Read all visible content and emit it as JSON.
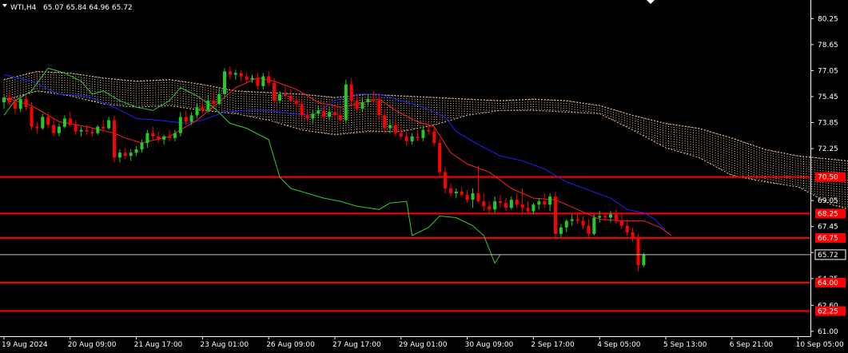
{
  "header": {
    "symbol_label": "WTI,H4",
    "ohlc_label": "65.07 65.84 64.96 65.72"
  },
  "chart_data": {
    "type": "candlestick",
    "symbol": "WTI",
    "timeframe": "H4",
    "last_price": 65.72,
    "ylim": [
      60.7,
      81.2
    ],
    "y_ticks": [
      "80.25",
      "78.65",
      "77.05",
      "75.45",
      "73.85",
      "72.25",
      "69.05",
      "67.45",
      "65.85",
      "64.25",
      "62.60",
      "61.00"
    ],
    "x_labels": [
      "19 Aug 2024",
      "20 Aug 09:00",
      "21 Aug 17:00",
      "23 Aug 01:00",
      "26 Aug 09:00",
      "27 Aug 17:00",
      "29 Aug 01:00",
      "30 Aug 09:00",
      "2 Sep 17:00",
      "4 Sep 05:00",
      "5 Sep 13:00",
      "6 Sep 21:00",
      "10 Sep 05:00"
    ],
    "x_label_bars": [
      0,
      12,
      24,
      36,
      48,
      60,
      72,
      84,
      96,
      108,
      120,
      132,
      144
    ],
    "levels": [
      {
        "label": "70.50",
        "value": 70.5
      },
      {
        "label": "68.25",
        "value": 68.25
      },
      {
        "label": "66.75",
        "value": 66.75
      },
      {
        "label": "64.00",
        "value": 64.0
      },
      {
        "label": "62.25",
        "value": 62.25
      }
    ],
    "colors": {
      "background": "#000000",
      "bull": "#22cc22",
      "bear": "#ff0000",
      "level_line": "#ff0000",
      "price_line": "#c0c0c0",
      "tenkan": "#ff2020",
      "kijun": "#2020ff",
      "chikou": "#33cc33",
      "cloud": "#f0c8a0",
      "axis_text": "#ffffff",
      "level_box": "#ff0000"
    },
    "candles": [
      [
        75.1,
        75.6,
        74.7,
        75.4
      ],
      [
        75.4,
        75.8,
        74.9,
        75.1
      ],
      [
        75.1,
        75.4,
        74.4,
        74.7
      ],
      [
        74.7,
        75.4,
        74.5,
        75.3
      ],
      [
        75.3,
        75.6,
        74.6,
        74.8
      ],
      [
        74.8,
        75.1,
        73.4,
        73.6
      ],
      [
        73.6,
        73.9,
        73.2,
        73.5
      ],
      [
        73.5,
        74.4,
        73.4,
        74.2
      ],
      [
        74.2,
        74.5,
        73.5,
        73.7
      ],
      [
        73.7,
        74.1,
        73.0,
        73.2
      ],
      [
        73.2,
        73.8,
        73.0,
        73.6
      ],
      [
        73.6,
        74.3,
        73.5,
        74.1
      ],
      [
        74.1,
        74.5,
        73.6,
        73.7
      ],
      [
        73.7,
        74.0,
        73.1,
        73.3
      ],
      [
        73.3,
        73.6,
        73.0,
        73.4
      ],
      [
        73.4,
        73.7,
        73.1,
        73.3
      ],
      [
        73.3,
        73.5,
        73.0,
        73.2
      ],
      [
        73.2,
        73.7,
        73.1,
        73.6
      ],
      [
        73.6,
        74.0,
        73.3,
        73.5
      ],
      [
        73.5,
        74.2,
        73.4,
        74.0
      ],
      [
        74.0,
        74.3,
        71.4,
        71.7
      ],
      [
        71.7,
        72.2,
        71.4,
        72.0
      ],
      [
        72.0,
        72.3,
        71.6,
        71.8
      ],
      [
        71.8,
        72.2,
        71.5,
        72.0
      ],
      [
        72.0,
        72.4,
        71.8,
        72.2
      ],
      [
        72.2,
        72.8,
        72.0,
        72.6
      ],
      [
        72.6,
        73.4,
        72.3,
        73.2
      ],
      [
        73.2,
        73.6,
        72.8,
        73.0
      ],
      [
        73.0,
        73.3,
        72.6,
        72.8
      ],
      [
        72.8,
        73.1,
        72.5,
        73.0
      ],
      [
        73.0,
        73.4,
        72.7,
        72.9
      ],
      [
        72.9,
        73.4,
        72.7,
        73.2
      ],
      [
        73.2,
        74.5,
        73.0,
        74.2
      ],
      [
        74.2,
        74.6,
        73.7,
        73.9
      ],
      [
        73.9,
        74.5,
        73.7,
        74.3
      ],
      [
        74.3,
        75.0,
        74.1,
        74.8
      ],
      [
        74.8,
        75.3,
        74.4,
        74.6
      ],
      [
        74.6,
        75.5,
        74.5,
        75.2
      ],
      [
        75.2,
        75.7,
        74.8,
        75.0
      ],
      [
        75.0,
        76.0,
        74.9,
        75.6
      ],
      [
        75.6,
        77.2,
        75.4,
        77.0
      ],
      [
        77.0,
        77.3,
        76.5,
        76.8
      ],
      [
        76.8,
        77.1,
        76.5,
        76.9
      ],
      [
        76.9,
        77.1,
        76.4,
        76.7
      ],
      [
        76.7,
        76.9,
        76.3,
        76.5
      ],
      [
        76.5,
        76.8,
        76.3,
        76.6
      ],
      [
        76.6,
        76.9,
        75.9,
        76.1
      ],
      [
        76.1,
        76.9,
        75.9,
        76.7
      ],
      [
        76.7,
        77.0,
        76.1,
        76.3
      ],
      [
        76.3,
        76.6,
        75.0,
        75.2
      ],
      [
        75.2,
        75.8,
        75.0,
        75.6
      ],
      [
        75.6,
        76.1,
        75.3,
        75.5
      ],
      [
        75.5,
        75.9,
        75.0,
        75.2
      ],
      [
        75.2,
        75.5,
        74.8,
        75.0
      ],
      [
        75.0,
        75.3,
        74.0,
        74.3
      ],
      [
        74.3,
        74.7,
        73.9,
        74.1
      ],
      [
        74.1,
        74.6,
        73.8,
        74.4
      ],
      [
        74.4,
        74.9,
        74.2,
        74.6
      ],
      [
        74.6,
        75.0,
        74.0,
        74.2
      ],
      [
        74.2,
        74.8,
        74.0,
        74.5
      ],
      [
        74.5,
        74.9,
        74.1,
        74.3
      ],
      [
        74.3,
        74.8,
        73.9,
        74.0
      ],
      [
        74.0,
        76.5,
        73.8,
        76.2
      ],
      [
        76.2,
        76.6,
        74.9,
        75.2
      ],
      [
        75.2,
        75.6,
        74.5,
        74.7
      ],
      [
        74.7,
        75.4,
        74.5,
        75.1
      ],
      [
        75.1,
        75.6,
        74.9,
        75.3
      ],
      [
        75.3,
        75.8,
        75.0,
        75.2
      ],
      [
        75.2,
        75.6,
        74.0,
        74.3
      ],
      [
        74.3,
        74.7,
        73.2,
        73.5
      ],
      [
        73.5,
        74.0,
        73.2,
        73.7
      ],
      [
        73.7,
        74.1,
        73.0,
        73.2
      ],
      [
        73.2,
        73.6,
        72.8,
        73.0
      ],
      [
        73.0,
        73.3,
        72.4,
        72.7
      ],
      [
        72.7,
        73.2,
        72.5,
        73.0
      ],
      [
        73.0,
        73.4,
        72.7,
        72.9
      ],
      [
        72.9,
        73.6,
        72.7,
        73.4
      ],
      [
        73.4,
        73.8,
        73.1,
        73.3
      ],
      [
        73.3,
        73.6,
        72.4,
        72.6
      ],
      [
        72.6,
        72.9,
        70.5,
        70.8
      ],
      [
        70.8,
        71.1,
        69.5,
        69.8
      ],
      [
        69.8,
        70.1,
        69.3,
        69.5
      ],
      [
        69.5,
        69.8,
        69.2,
        69.6
      ],
      [
        69.6,
        69.9,
        69.3,
        69.4
      ],
      [
        69.4,
        69.7,
        68.9,
        69.1
      ],
      [
        69.1,
        69.8,
        68.6,
        69.5
      ],
      [
        69.5,
        71.2,
        68.9,
        69.0
      ],
      [
        69.0,
        69.5,
        68.4,
        68.7
      ],
      [
        68.7,
        69.0,
        68.2,
        68.5
      ],
      [
        68.5,
        69.3,
        68.3,
        69.0
      ],
      [
        69.0,
        69.4,
        68.6,
        68.9
      ],
      [
        68.9,
        69.2,
        68.4,
        68.6
      ],
      [
        68.6,
        69.3,
        68.5,
        69.1
      ],
      [
        69.1,
        69.5,
        68.6,
        68.8
      ],
      [
        68.8,
        69.8,
        68.3,
        68.6
      ],
      [
        68.6,
        69.0,
        68.2,
        68.4
      ],
      [
        68.4,
        68.9,
        68.2,
        68.8
      ],
      [
        68.8,
        69.2,
        68.5,
        69.0
      ],
      [
        69.0,
        69.5,
        68.6,
        68.8
      ],
      [
        68.8,
        69.5,
        68.4,
        69.3
      ],
      [
        69.3,
        69.6,
        66.8,
        67.0
      ],
      [
        67.0,
        67.6,
        66.8,
        67.4
      ],
      [
        67.4,
        67.9,
        67.1,
        67.8
      ],
      [
        67.8,
        68.2,
        67.5,
        67.9
      ],
      [
        67.9,
        68.3,
        67.6,
        67.8
      ],
      [
        67.8,
        68.1,
        67.3,
        67.5
      ],
      [
        67.5,
        67.9,
        66.8,
        67.0
      ],
      [
        67.0,
        68.2,
        66.9,
        68.0
      ],
      [
        68.0,
        68.4,
        67.7,
        68.1
      ],
      [
        68.1,
        68.3,
        67.8,
        68.0
      ],
      [
        68.0,
        68.4,
        67.7,
        68.2
      ],
      [
        68.2,
        68.5,
        67.6,
        67.8
      ],
      [
        67.8,
        68.2,
        67.3,
        67.5
      ],
      [
        67.5,
        67.9,
        66.9,
        67.1
      ],
      [
        67.1,
        67.4,
        66.5,
        66.7
      ],
      [
        66.7,
        67.0,
        64.7,
        65.07
      ],
      [
        65.07,
        65.84,
        64.96,
        65.72
      ]
    ],
    "tenkan": [
      [
        0,
        75.4
      ],
      [
        5,
        74.9
      ],
      [
        10,
        73.9
      ],
      [
        15,
        73.6
      ],
      [
        20,
        73.2
      ],
      [
        22,
        72.9
      ],
      [
        25,
        72.6
      ],
      [
        30,
        73.0
      ],
      [
        35,
        74.0
      ],
      [
        39,
        75.1
      ],
      [
        42,
        76.0
      ],
      [
        46,
        76.6
      ],
      [
        49,
        76.4
      ],
      [
        53,
        75.9
      ],
      [
        57,
        75.1
      ],
      [
        61,
        74.8
      ],
      [
        64,
        75.0
      ],
      [
        68,
        75.3
      ],
      [
        71,
        74.6
      ],
      [
        75,
        73.9
      ],
      [
        78,
        73.6
      ],
      [
        81,
        72.0
      ],
      [
        84,
        71.3
      ],
      [
        88,
        70.8
      ],
      [
        92,
        69.8
      ],
      [
        96,
        69.2
      ],
      [
        100,
        69.1
      ],
      [
        104,
        68.5
      ],
      [
        108,
        67.9
      ],
      [
        112,
        67.8
      ],
      [
        116,
        67.8
      ],
      [
        119,
        67.4
      ],
      [
        121,
        66.9
      ]
    ],
    "kijun": [
      [
        0,
        76.8
      ],
      [
        5,
        76.4
      ],
      [
        10,
        75.6
      ],
      [
        15,
        75.5
      ],
      [
        20,
        74.8
      ],
      [
        24,
        74.1
      ],
      [
        28,
        74.0
      ],
      [
        33,
        73.8
      ],
      [
        36,
        74.0
      ],
      [
        40,
        74.5
      ],
      [
        44,
        74.6
      ],
      [
        48,
        74.6
      ],
      [
        52,
        74.4
      ],
      [
        56,
        74.3
      ],
      [
        60,
        75.2
      ],
      [
        64,
        75.6
      ],
      [
        68,
        75.6
      ],
      [
        72,
        75.2
      ],
      [
        76,
        74.8
      ],
      [
        80,
        74.2
      ],
      [
        82,
        73.3
      ],
      [
        86,
        72.5
      ],
      [
        90,
        71.8
      ],
      [
        94,
        71.5
      ],
      [
        98,
        71.0
      ],
      [
        102,
        70.2
      ],
      [
        106,
        69.7
      ],
      [
        110,
        69.2
      ],
      [
        113,
        68.5
      ],
      [
        116,
        68.3
      ],
      [
        118,
        67.9
      ],
      [
        120,
        67.2
      ]
    ],
    "chikou": [
      [
        0,
        74.3
      ],
      [
        2,
        75.2
      ],
      [
        5,
        75.8
      ],
      [
        8,
        77.2
      ],
      [
        11,
        76.9
      ],
      [
        14,
        76.4
      ],
      [
        16,
        75.6
      ],
      [
        18,
        75.8
      ],
      [
        21,
        75.2
      ],
      [
        24,
        74.8
      ],
      [
        27,
        74.6
      ],
      [
        30,
        75.2
      ],
      [
        32,
        76.0
      ],
      [
        35,
        75.5
      ],
      [
        38,
        74.8
      ],
      [
        41,
        73.8
      ],
      [
        44,
        73.5
      ],
      [
        48,
        72.8
      ],
      [
        50,
        70.5
      ],
      [
        52,
        69.8
      ],
      [
        55,
        69.5
      ],
      [
        58,
        69.2
      ],
      [
        61,
        69.0
      ],
      [
        64,
        68.7
      ],
      [
        66,
        68.6
      ],
      [
        68,
        68.5
      ],
      [
        70,
        68.9
      ],
      [
        73,
        69.0
      ],
      [
        74,
        66.9
      ],
      [
        77,
        67.4
      ],
      [
        79,
        68.1
      ],
      [
        82,
        68.0
      ],
      [
        85,
        67.5
      ],
      [
        87,
        66.9
      ],
      [
        89,
        65.2
      ],
      [
        90,
        65.72
      ]
    ],
    "cloud": [
      [
        0,
        76.5,
        75.2
      ],
      [
        6,
        77.0,
        75.8
      ],
      [
        12,
        76.9,
        75.5
      ],
      [
        18,
        76.6,
        75.0
      ],
      [
        24,
        76.4,
        74.8
      ],
      [
        30,
        76.5,
        74.9
      ],
      [
        36,
        76.2,
        74.6
      ],
      [
        42,
        75.8,
        74.4
      ],
      [
        48,
        75.7,
        74.0
      ],
      [
        54,
        75.6,
        73.4
      ],
      [
        60,
        75.4,
        73.1
      ],
      [
        66,
        75.6,
        73.3
      ],
      [
        72,
        75.5,
        73.3
      ],
      [
        78,
        75.4,
        73.7
      ],
      [
        84,
        75.3,
        74.3
      ],
      [
        90,
        75.2,
        74.6
      ],
      [
        96,
        75.3,
        74.6
      ],
      [
        102,
        75.2,
        74.5
      ],
      [
        108,
        74.9,
        74.4
      ],
      [
        114,
        74.3,
        73.4
      ],
      [
        120,
        73.8,
        72.3
      ],
      [
        126,
        73.5,
        71.7
      ],
      [
        132,
        72.9,
        70.6
      ],
      [
        138,
        72.2,
        70.2
      ],
      [
        144,
        71.8,
        69.9
      ],
      [
        150,
        71.6,
        68.8
      ],
      [
        156,
        71.4,
        68.3
      ],
      [
        160,
        70.8,
        68.0
      ],
      [
        163,
        70.0,
        67.4
      ]
    ]
  }
}
